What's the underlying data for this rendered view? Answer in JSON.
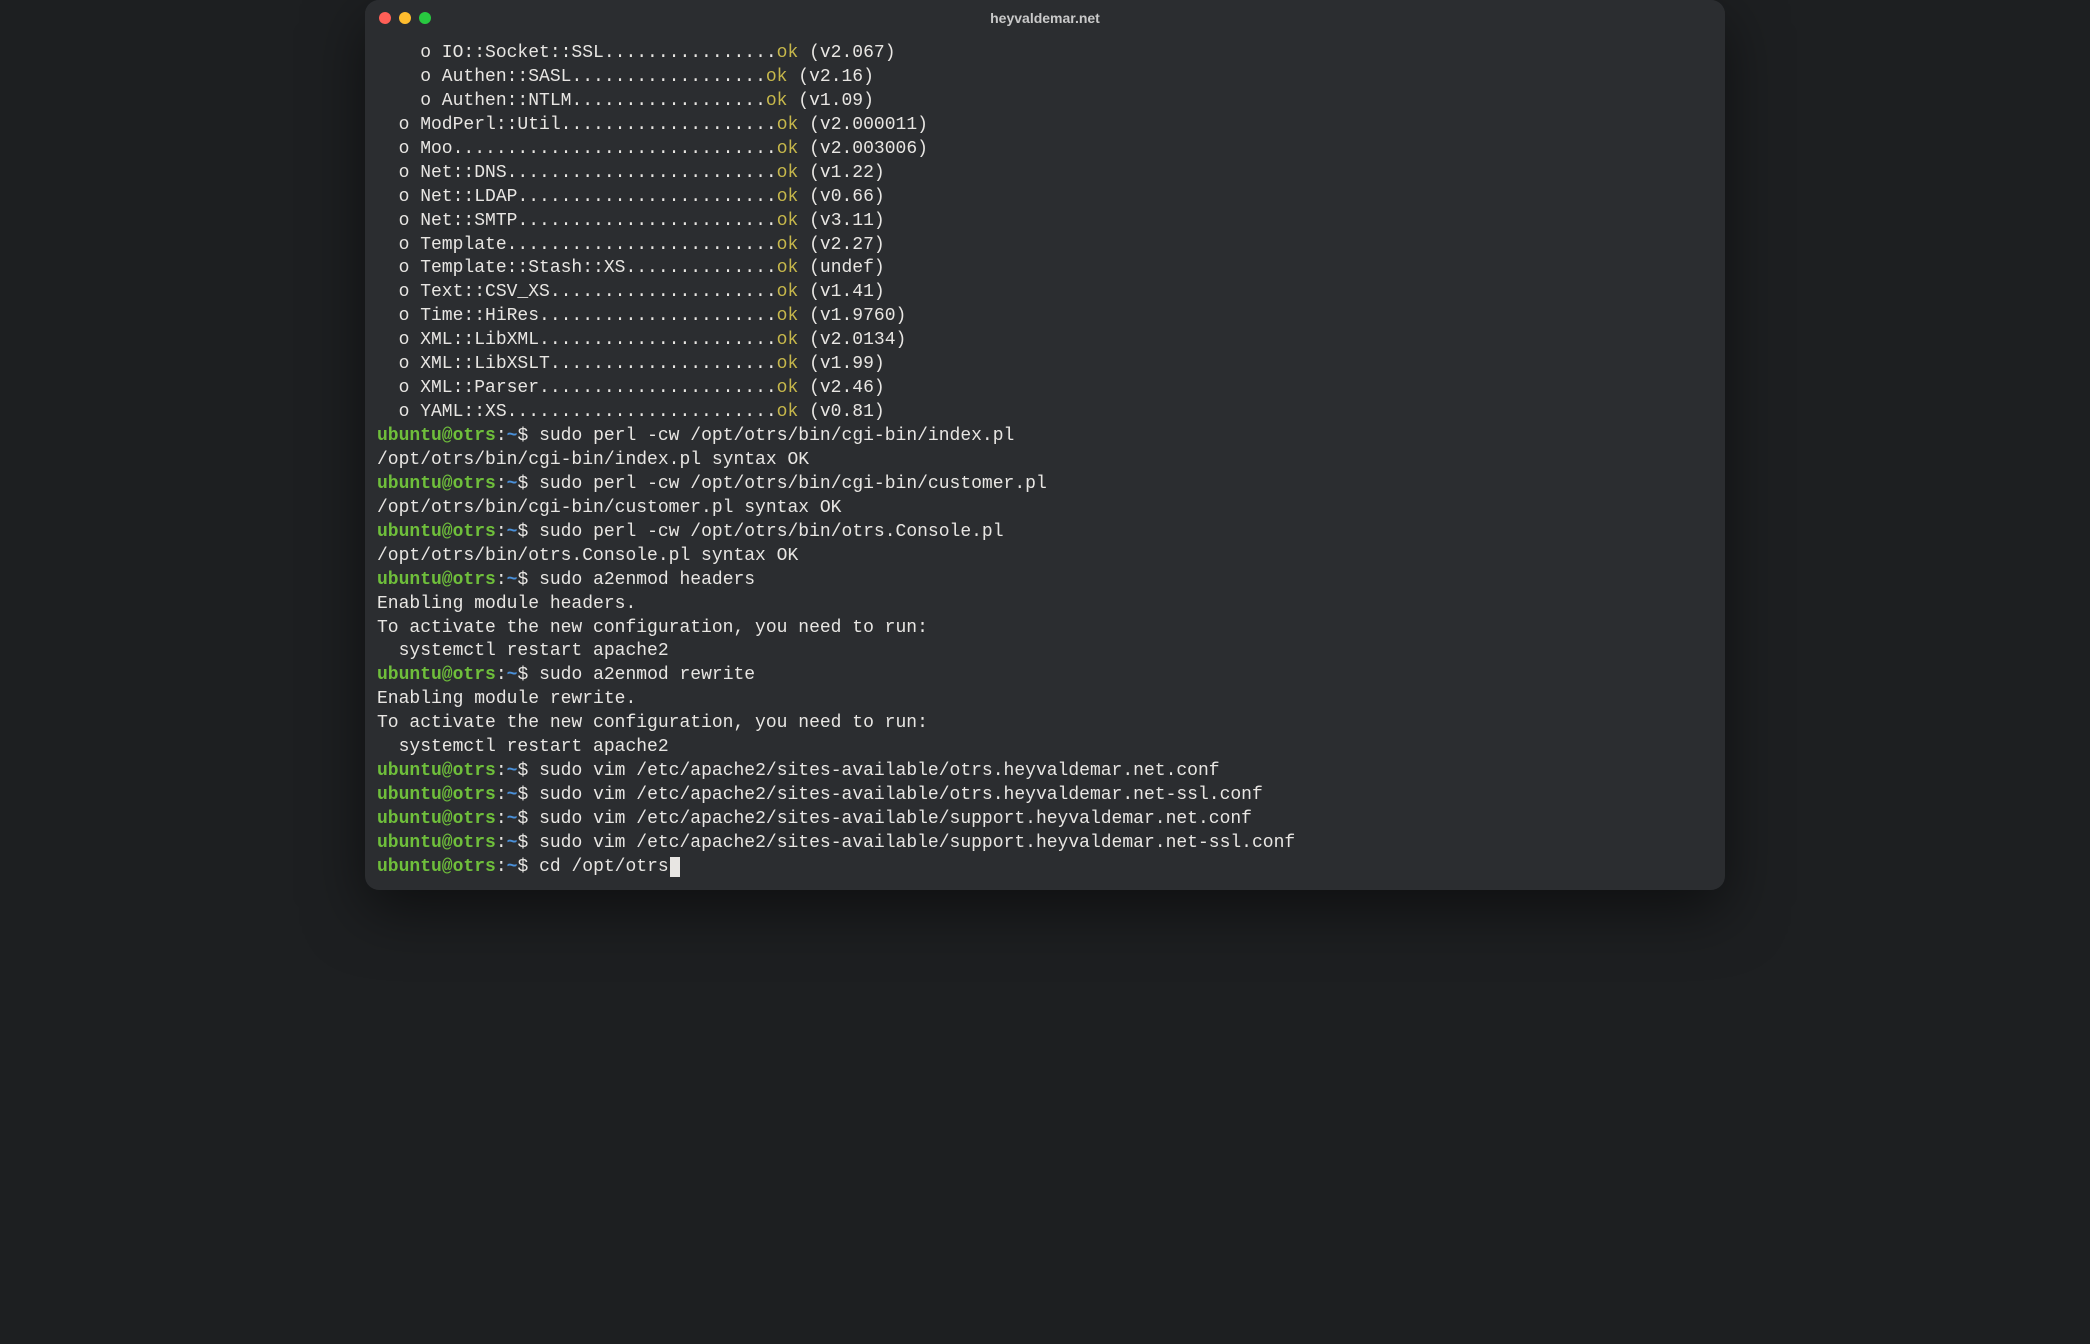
{
  "window": {
    "title": "heyvaldemar.net"
  },
  "colors": {
    "ok": "#c7b84b",
    "promptUser": "#6fbf3b",
    "promptPath": "#4a90d9",
    "background": "#2b2d30",
    "text": "#e8e6e3"
  },
  "prompt": {
    "user": "ubuntu@otrs",
    "sep": ":",
    "path": "~",
    "sigil": "$"
  },
  "modules": [
    {
      "indent": 4,
      "name": "IO::Socket::SSL",
      "dots": 16,
      "status": "ok",
      "version": "(v2.067)"
    },
    {
      "indent": 4,
      "name": "Authen::SASL",
      "dots": 18,
      "status": "ok",
      "version": "(v2.16)"
    },
    {
      "indent": 4,
      "name": "Authen::NTLM",
      "dots": 18,
      "status": "ok",
      "version": "(v1.09)"
    },
    {
      "indent": 2,
      "name": "ModPerl::Util",
      "dots": 20,
      "status": "ok",
      "version": "(v2.000011)"
    },
    {
      "indent": 2,
      "name": "Moo",
      "dots": 30,
      "status": "ok",
      "version": "(v2.003006)"
    },
    {
      "indent": 2,
      "name": "Net::DNS",
      "dots": 25,
      "status": "ok",
      "version": "(v1.22)"
    },
    {
      "indent": 2,
      "name": "Net::LDAP",
      "dots": 24,
      "status": "ok",
      "version": "(v0.66)"
    },
    {
      "indent": 2,
      "name": "Net::SMTP",
      "dots": 24,
      "status": "ok",
      "version": "(v3.11)"
    },
    {
      "indent": 2,
      "name": "Template",
      "dots": 25,
      "status": "ok",
      "version": "(v2.27)"
    },
    {
      "indent": 2,
      "name": "Template::Stash::XS",
      "dots": 14,
      "status": "ok",
      "version": "(undef)"
    },
    {
      "indent": 2,
      "name": "Text::CSV_XS",
      "dots": 21,
      "status": "ok",
      "version": "(v1.41)"
    },
    {
      "indent": 2,
      "name": "Time::HiRes",
      "dots": 22,
      "status": "ok",
      "version": "(v1.9760)"
    },
    {
      "indent": 2,
      "name": "XML::LibXML",
      "dots": 22,
      "status": "ok",
      "version": "(v2.0134)"
    },
    {
      "indent": 2,
      "name": "XML::LibXSLT",
      "dots": 21,
      "status": "ok",
      "version": "(v1.99)"
    },
    {
      "indent": 2,
      "name": "XML::Parser",
      "dots": 22,
      "status": "ok",
      "version": "(v2.46)"
    },
    {
      "indent": 2,
      "name": "YAML::XS",
      "dots": 25,
      "status": "ok",
      "version": "(v0.81)"
    }
  ],
  "session": [
    {
      "type": "prompt",
      "cmd": "sudo perl -cw /opt/otrs/bin/cgi-bin/index.pl"
    },
    {
      "type": "output",
      "text": "/opt/otrs/bin/cgi-bin/index.pl syntax OK"
    },
    {
      "type": "prompt",
      "cmd": "sudo perl -cw /opt/otrs/bin/cgi-bin/customer.pl"
    },
    {
      "type": "output",
      "text": "/opt/otrs/bin/cgi-bin/customer.pl syntax OK"
    },
    {
      "type": "prompt",
      "cmd": "sudo perl -cw /opt/otrs/bin/otrs.Console.pl"
    },
    {
      "type": "output",
      "text": "/opt/otrs/bin/otrs.Console.pl syntax OK"
    },
    {
      "type": "prompt",
      "cmd": "sudo a2enmod headers"
    },
    {
      "type": "output",
      "text": "Enabling module headers."
    },
    {
      "type": "output",
      "text": "To activate the new configuration, you need to run:"
    },
    {
      "type": "output",
      "text": "  systemctl restart apache2"
    },
    {
      "type": "prompt",
      "cmd": "sudo a2enmod rewrite"
    },
    {
      "type": "output",
      "text": "Enabling module rewrite."
    },
    {
      "type": "output",
      "text": "To activate the new configuration, you need to run:"
    },
    {
      "type": "output",
      "text": "  systemctl restart apache2"
    },
    {
      "type": "prompt",
      "cmd": "sudo vim /etc/apache2/sites-available/otrs.heyvaldemar.net.conf"
    },
    {
      "type": "prompt",
      "cmd": "sudo vim /etc/apache2/sites-available/otrs.heyvaldemar.net-ssl.conf"
    },
    {
      "type": "prompt",
      "cmd": "sudo vim /etc/apache2/sites-available/support.heyvaldemar.net.conf"
    },
    {
      "type": "prompt",
      "cmd": "sudo vim /etc/apache2/sites-available/support.heyvaldemar.net-ssl.conf"
    }
  ],
  "current": {
    "cmd": "cd /opt/otrs"
  }
}
